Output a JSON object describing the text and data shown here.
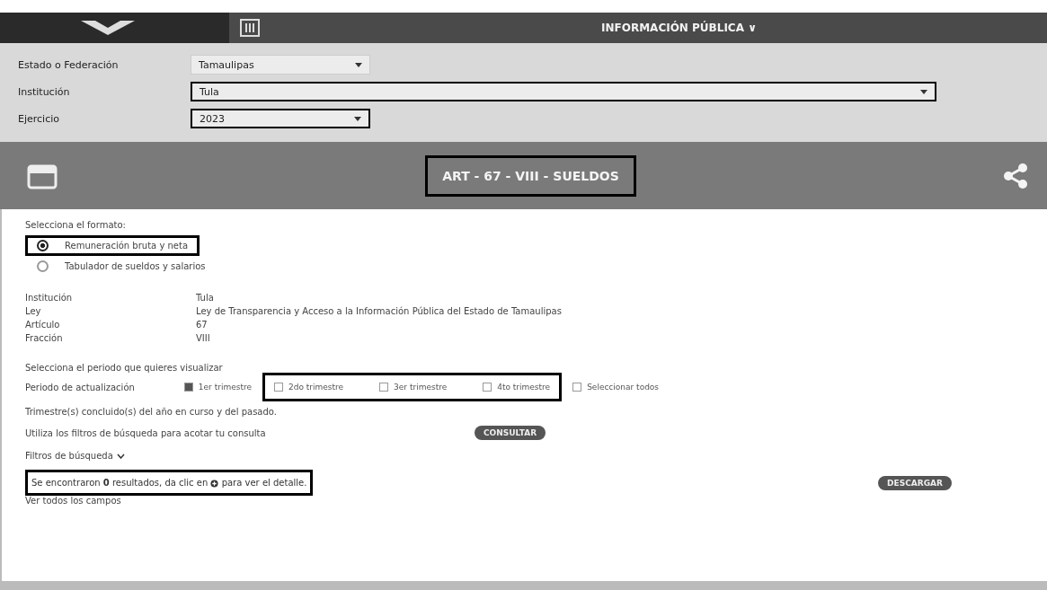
{
  "header": {
    "menu_label": "INFORMACIÓN PÚBLICA ∨"
  },
  "filters": [
    {
      "kind": "select",
      "label": "Estado o Federación",
      "value": "Tamaulipas",
      "highlighted": false,
      "wide": false
    },
    {
      "kind": "select",
      "label": "Institución",
      "value": "Tula",
      "highlighted": true,
      "wide": true
    },
    {
      "kind": "select",
      "label": "Ejercicio",
      "value": "2023",
      "highlighted": true,
      "wide": false
    }
  ],
  "title_bar": {
    "title": "ART - 67 - VIII - SUELDOS",
    "highlighted": true
  },
  "format": {
    "prompt": "Selecciona el formato:",
    "options": [
      {
        "label": "Remuneración bruta y neta",
        "selected": true,
        "highlighted": true
      },
      {
        "label": "Tabulador de sueldos y salarios",
        "selected": false,
        "highlighted": false
      }
    ]
  },
  "details": [
    {
      "label": "Institución",
      "value": "Tula"
    },
    {
      "label": "Ley",
      "value": "Ley de Transparencia y Acceso a la Información Pública del Estado de Tamaulipas"
    },
    {
      "label": "Artículo",
      "value": "67"
    },
    {
      "label": "Fracción",
      "value": "VIII"
    }
  ],
  "period": {
    "prompt": "Selecciona el periodo que quieres visualizar",
    "label": "Periodo de actualización",
    "options": [
      {
        "label": "1er trimestre",
        "checked": true,
        "highlighted": false
      },
      {
        "label": "2do trimestre",
        "checked": false,
        "highlighted": true
      },
      {
        "label": "3er trimestre",
        "checked": false,
        "highlighted": true
      },
      {
        "label": "4to trimestre",
        "checked": false,
        "highlighted": true
      },
      {
        "label": "Seleccionar todos",
        "checked": false,
        "highlighted": false
      }
    ],
    "note": "Trimestre(s) concluido(s) del año en curso y del pasado."
  },
  "query": {
    "text": "Utiliza los filtros de búsqueda para acotar tu consulta",
    "button": "CONSULTAR"
  },
  "search_filters": {
    "label": "Filtros de búsqueda"
  },
  "results": {
    "before": "Se encontraron ",
    "count": "0",
    "middle": " resultados, da clic en ",
    "after": " para ver el detalle.",
    "highlighted": true,
    "button": "DESCARGAR",
    "link": "Ver todos los campos"
  }
}
